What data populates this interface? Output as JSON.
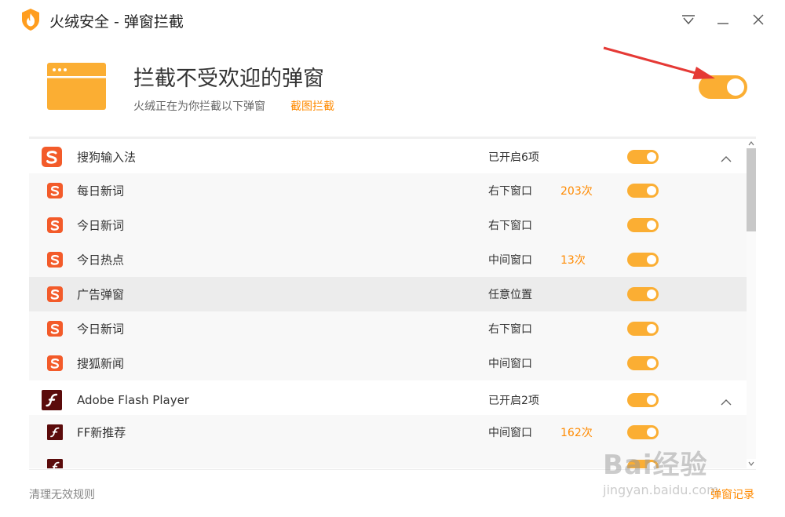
{
  "window": {
    "title": "火绒安全 - 弹窗拦截",
    "logo_icon": "huorong-flame-icon",
    "controls": [
      "menu-icon",
      "minimize-icon",
      "close-icon"
    ]
  },
  "header": {
    "icon": "browser-window-icon",
    "title": "拦截不受欢迎的弹窗",
    "subtitle": "火绒正在为你拦截以下弹窗",
    "link": "截图拦截",
    "master_toggle_on": true
  },
  "list": {
    "rows": [
      {
        "type": "group",
        "icon": "sogou-icon",
        "name": "搜狗输入法",
        "position": "已开启6项",
        "count": "",
        "on": true,
        "chevron": "up"
      },
      {
        "type": "child",
        "icon": "sogou-icon",
        "name": "每日新词",
        "position": "右下窗口",
        "count": "203次",
        "on": true
      },
      {
        "type": "child",
        "icon": "sogou-icon",
        "name": "今日新词",
        "position": "右下窗口",
        "count": "",
        "on": true
      },
      {
        "type": "child",
        "icon": "sogou-icon",
        "name": "今日热点",
        "position": "中间窗口",
        "count": "13次",
        "on": true
      },
      {
        "type": "child",
        "icon": "sogou-icon",
        "name": "广告弹窗",
        "position": "任意位置",
        "count": "",
        "on": true,
        "hover": true
      },
      {
        "type": "child",
        "icon": "sogou-icon",
        "name": "今日新词",
        "position": "右下窗口",
        "count": "",
        "on": true
      },
      {
        "type": "child",
        "icon": "sogou-icon",
        "name": "搜狐新闻",
        "position": "中间窗口",
        "count": "",
        "on": true
      },
      {
        "type": "group",
        "icon": "flash-icon",
        "name": "Adobe Flash Player",
        "position": "已开启2项",
        "count": "",
        "on": true,
        "chevron": "up"
      },
      {
        "type": "child",
        "icon": "flash-icon",
        "name": "FF新推荐",
        "position": "中间窗口",
        "count": "162次",
        "on": true
      },
      {
        "type": "child",
        "icon": "flash-icon",
        "name": "",
        "position": "",
        "count": "",
        "on": true
      }
    ]
  },
  "footer": {
    "clean_label": "清理无效规则",
    "records_label": "弹窗记录"
  },
  "watermark": {
    "main": "Bai经验",
    "sub": "jingyan.baidu.com"
  },
  "colors": {
    "accent": "#fbae33",
    "link": "#ff8a00",
    "sogou": "#f35b2a",
    "flash": "#5b0b0b",
    "arrow": "#e53935"
  }
}
